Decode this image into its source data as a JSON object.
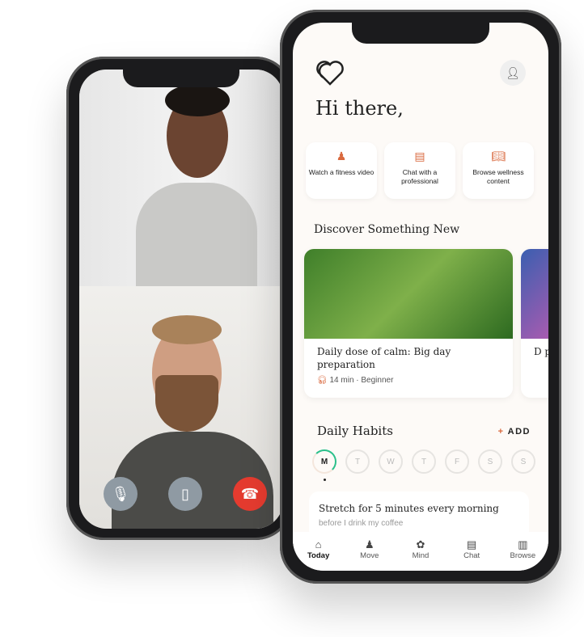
{
  "call": {
    "controls": [
      {
        "name": "mic",
        "icon": "microphone-icon"
      },
      {
        "name": "device",
        "icon": "phone-device-icon"
      },
      {
        "name": "end",
        "icon": "end-call-icon",
        "color": "#e53b2f"
      }
    ]
  },
  "app": {
    "greeting": "Hi there,",
    "quick_actions": [
      {
        "label": "Watch a fitness video",
        "icon": "fitness-icon"
      },
      {
        "label": "Chat with a professional",
        "icon": "chat-icon"
      },
      {
        "label": "Browse wellness content",
        "icon": "book-icon"
      }
    ],
    "discover_title": "Discover Something New",
    "cards": [
      {
        "title": "Daily dose of calm: Big day preparation",
        "meta": "14 min · Beginner",
        "icon": "headphones-icon"
      },
      {
        "title": "D p",
        "meta": ""
      }
    ],
    "habits_title": "Daily Habits",
    "add_label": "ADD",
    "add_symbol": "+",
    "days": [
      "M",
      "T",
      "W",
      "T",
      "F",
      "S",
      "S"
    ],
    "habit": {
      "title": "Stretch for 5 minutes every morning",
      "subtitle": "before I drink my coffee"
    },
    "nav": [
      {
        "label": "Today",
        "icon": "home-icon"
      },
      {
        "label": "Move",
        "icon": "move-icon"
      },
      {
        "label": "Mind",
        "icon": "brain-icon"
      },
      {
        "label": "Chat",
        "icon": "chat-icon"
      },
      {
        "label": "Browse",
        "icon": "book-icon"
      }
    ],
    "accent": "#d9693e",
    "progress_color": "#2bc08b"
  }
}
